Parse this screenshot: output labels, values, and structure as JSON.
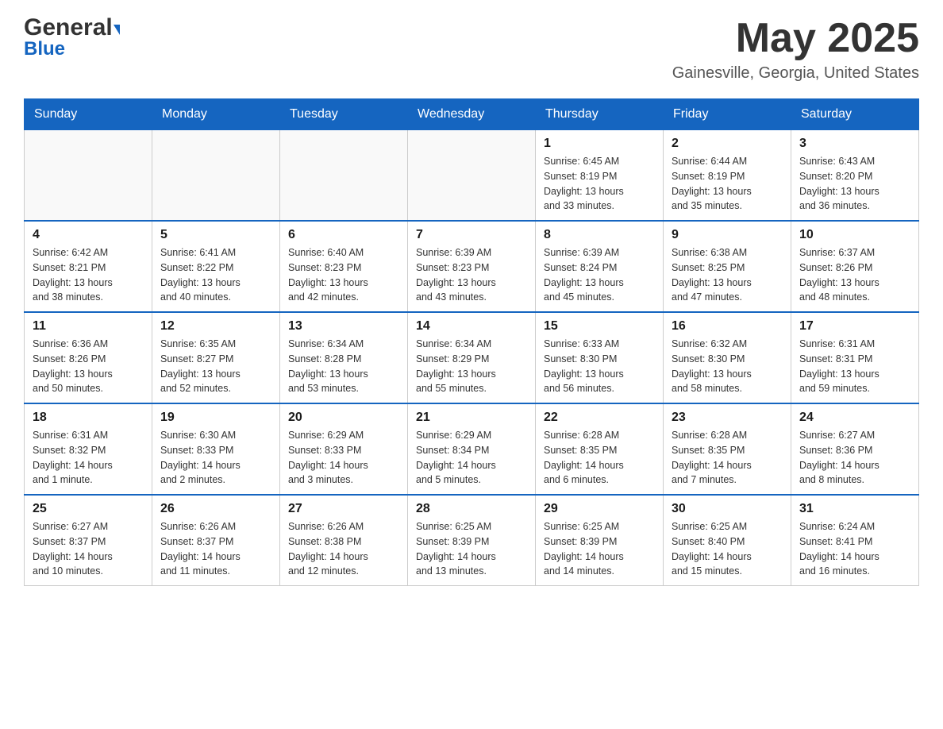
{
  "header": {
    "logo_general": "General",
    "logo_blue": "Blue",
    "month_year": "May 2025",
    "location": "Gainesville, Georgia, United States"
  },
  "weekdays": [
    "Sunday",
    "Monday",
    "Tuesday",
    "Wednesday",
    "Thursday",
    "Friday",
    "Saturday"
  ],
  "rows": [
    {
      "days": [
        {
          "number": "",
          "info": ""
        },
        {
          "number": "",
          "info": ""
        },
        {
          "number": "",
          "info": ""
        },
        {
          "number": "",
          "info": ""
        },
        {
          "number": "1",
          "info": "Sunrise: 6:45 AM\nSunset: 8:19 PM\nDaylight: 13 hours\nand 33 minutes."
        },
        {
          "number": "2",
          "info": "Sunrise: 6:44 AM\nSunset: 8:19 PM\nDaylight: 13 hours\nand 35 minutes."
        },
        {
          "number": "3",
          "info": "Sunrise: 6:43 AM\nSunset: 8:20 PM\nDaylight: 13 hours\nand 36 minutes."
        }
      ]
    },
    {
      "days": [
        {
          "number": "4",
          "info": "Sunrise: 6:42 AM\nSunset: 8:21 PM\nDaylight: 13 hours\nand 38 minutes."
        },
        {
          "number": "5",
          "info": "Sunrise: 6:41 AM\nSunset: 8:22 PM\nDaylight: 13 hours\nand 40 minutes."
        },
        {
          "number": "6",
          "info": "Sunrise: 6:40 AM\nSunset: 8:23 PM\nDaylight: 13 hours\nand 42 minutes."
        },
        {
          "number": "7",
          "info": "Sunrise: 6:39 AM\nSunset: 8:23 PM\nDaylight: 13 hours\nand 43 minutes."
        },
        {
          "number": "8",
          "info": "Sunrise: 6:39 AM\nSunset: 8:24 PM\nDaylight: 13 hours\nand 45 minutes."
        },
        {
          "number": "9",
          "info": "Sunrise: 6:38 AM\nSunset: 8:25 PM\nDaylight: 13 hours\nand 47 minutes."
        },
        {
          "number": "10",
          "info": "Sunrise: 6:37 AM\nSunset: 8:26 PM\nDaylight: 13 hours\nand 48 minutes."
        }
      ]
    },
    {
      "days": [
        {
          "number": "11",
          "info": "Sunrise: 6:36 AM\nSunset: 8:26 PM\nDaylight: 13 hours\nand 50 minutes."
        },
        {
          "number": "12",
          "info": "Sunrise: 6:35 AM\nSunset: 8:27 PM\nDaylight: 13 hours\nand 52 minutes."
        },
        {
          "number": "13",
          "info": "Sunrise: 6:34 AM\nSunset: 8:28 PM\nDaylight: 13 hours\nand 53 minutes."
        },
        {
          "number": "14",
          "info": "Sunrise: 6:34 AM\nSunset: 8:29 PM\nDaylight: 13 hours\nand 55 minutes."
        },
        {
          "number": "15",
          "info": "Sunrise: 6:33 AM\nSunset: 8:30 PM\nDaylight: 13 hours\nand 56 minutes."
        },
        {
          "number": "16",
          "info": "Sunrise: 6:32 AM\nSunset: 8:30 PM\nDaylight: 13 hours\nand 58 minutes."
        },
        {
          "number": "17",
          "info": "Sunrise: 6:31 AM\nSunset: 8:31 PM\nDaylight: 13 hours\nand 59 minutes."
        }
      ]
    },
    {
      "days": [
        {
          "number": "18",
          "info": "Sunrise: 6:31 AM\nSunset: 8:32 PM\nDaylight: 14 hours\nand 1 minute."
        },
        {
          "number": "19",
          "info": "Sunrise: 6:30 AM\nSunset: 8:33 PM\nDaylight: 14 hours\nand 2 minutes."
        },
        {
          "number": "20",
          "info": "Sunrise: 6:29 AM\nSunset: 8:33 PM\nDaylight: 14 hours\nand 3 minutes."
        },
        {
          "number": "21",
          "info": "Sunrise: 6:29 AM\nSunset: 8:34 PM\nDaylight: 14 hours\nand 5 minutes."
        },
        {
          "number": "22",
          "info": "Sunrise: 6:28 AM\nSunset: 8:35 PM\nDaylight: 14 hours\nand 6 minutes."
        },
        {
          "number": "23",
          "info": "Sunrise: 6:28 AM\nSunset: 8:35 PM\nDaylight: 14 hours\nand 7 minutes."
        },
        {
          "number": "24",
          "info": "Sunrise: 6:27 AM\nSunset: 8:36 PM\nDaylight: 14 hours\nand 8 minutes."
        }
      ]
    },
    {
      "days": [
        {
          "number": "25",
          "info": "Sunrise: 6:27 AM\nSunset: 8:37 PM\nDaylight: 14 hours\nand 10 minutes."
        },
        {
          "number": "26",
          "info": "Sunrise: 6:26 AM\nSunset: 8:37 PM\nDaylight: 14 hours\nand 11 minutes."
        },
        {
          "number": "27",
          "info": "Sunrise: 6:26 AM\nSunset: 8:38 PM\nDaylight: 14 hours\nand 12 minutes."
        },
        {
          "number": "28",
          "info": "Sunrise: 6:25 AM\nSunset: 8:39 PM\nDaylight: 14 hours\nand 13 minutes."
        },
        {
          "number": "29",
          "info": "Sunrise: 6:25 AM\nSunset: 8:39 PM\nDaylight: 14 hours\nand 14 minutes."
        },
        {
          "number": "30",
          "info": "Sunrise: 6:25 AM\nSunset: 8:40 PM\nDaylight: 14 hours\nand 15 minutes."
        },
        {
          "number": "31",
          "info": "Sunrise: 6:24 AM\nSunset: 8:41 PM\nDaylight: 14 hours\nand 16 minutes."
        }
      ]
    }
  ]
}
